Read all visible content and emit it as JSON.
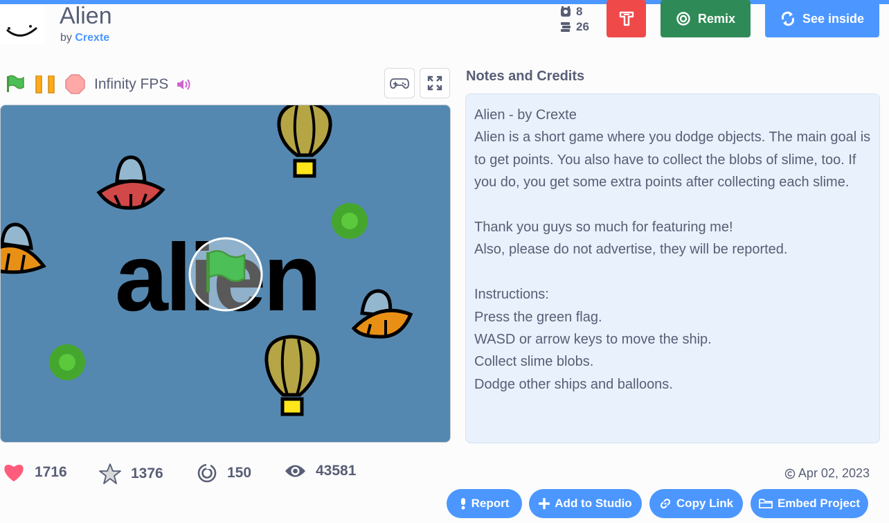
{
  "project": {
    "title": "Alien",
    "by_label": "by",
    "author": "Crexte"
  },
  "header_counts": {
    "remixes_count": "8",
    "studios_count": "26"
  },
  "actions": {
    "remix_label": "Remix",
    "see_inside_label": "See inside"
  },
  "player": {
    "fps_label": "Infinity FPS"
  },
  "notes": {
    "heading": "Notes and Credits",
    "paragraphs": [
      "Alien - by Crexte\nAlien is a short game where you dodge objects. The main goal is to get points. You also have to collect the blobs of slime, too. If you do, you get some extra points after collecting each slime.",
      "Thank you guys so much for featuring me!\nAlso, please do not advertise, they will be reported.",
      "Instructions:\nPress the green flag.\nWASD or arrow keys to move the ship.\nCollect slime blobs.\nDodge other ships and balloons."
    ]
  },
  "stats": {
    "loves": "1716",
    "favorites": "1376",
    "remixes": "150",
    "views": "43581"
  },
  "date": "Apr 02, 2023",
  "footer_buttons": {
    "report": "Report",
    "add_to_studio": "Add to Studio",
    "copy_link": "Copy Link",
    "embed": "Embed Project"
  },
  "stage_text": "alien",
  "colors": {
    "accent": "#4c97ff",
    "remix": "#2e8b57",
    "stage_bg": "#5588b0",
    "love": "#ff5c7c"
  }
}
